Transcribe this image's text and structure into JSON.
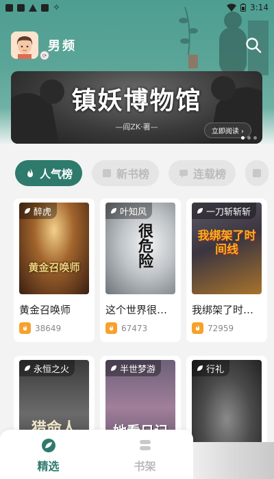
{
  "status_bar": {
    "time": "3:14"
  },
  "header": {
    "channel_label": "男频"
  },
  "banner": {
    "title": "镇妖博物馆",
    "author": "—阎ZK·著—",
    "read_button": "立即阅读",
    "page_count": 3,
    "active_page": 1
  },
  "tabs": [
    {
      "label": "人气榜",
      "active": true
    },
    {
      "label": "新书榜",
      "active": false
    },
    {
      "label": "连载榜",
      "active": false
    }
  ],
  "books": [
    {
      "tag": "醉虎",
      "title": "黄金召唤师",
      "heat": "38649",
      "cover_text": "黄金召唤师"
    },
    {
      "tag": "叶知风",
      "title": "这个世界很…",
      "heat": "67473",
      "cover_text": "很危险"
    },
    {
      "tag": "一刀斩斩斩",
      "title": "我绑架了时…",
      "heat": "72959",
      "cover_text": "我绑架了时间线"
    },
    {
      "tag": "永恒之火",
      "cover_text": "猎命人"
    },
    {
      "tag": "半世梦游",
      "cover_text": "她看日记"
    },
    {
      "tag": "行礼"
    }
  ],
  "bottom_nav": [
    {
      "label": "精选",
      "active": true
    },
    {
      "label": "书架",
      "active": false
    }
  ],
  "colors": {
    "accent": "#2e7a6c",
    "header_teal": "#5aa597",
    "flame": "#f7a12b"
  }
}
